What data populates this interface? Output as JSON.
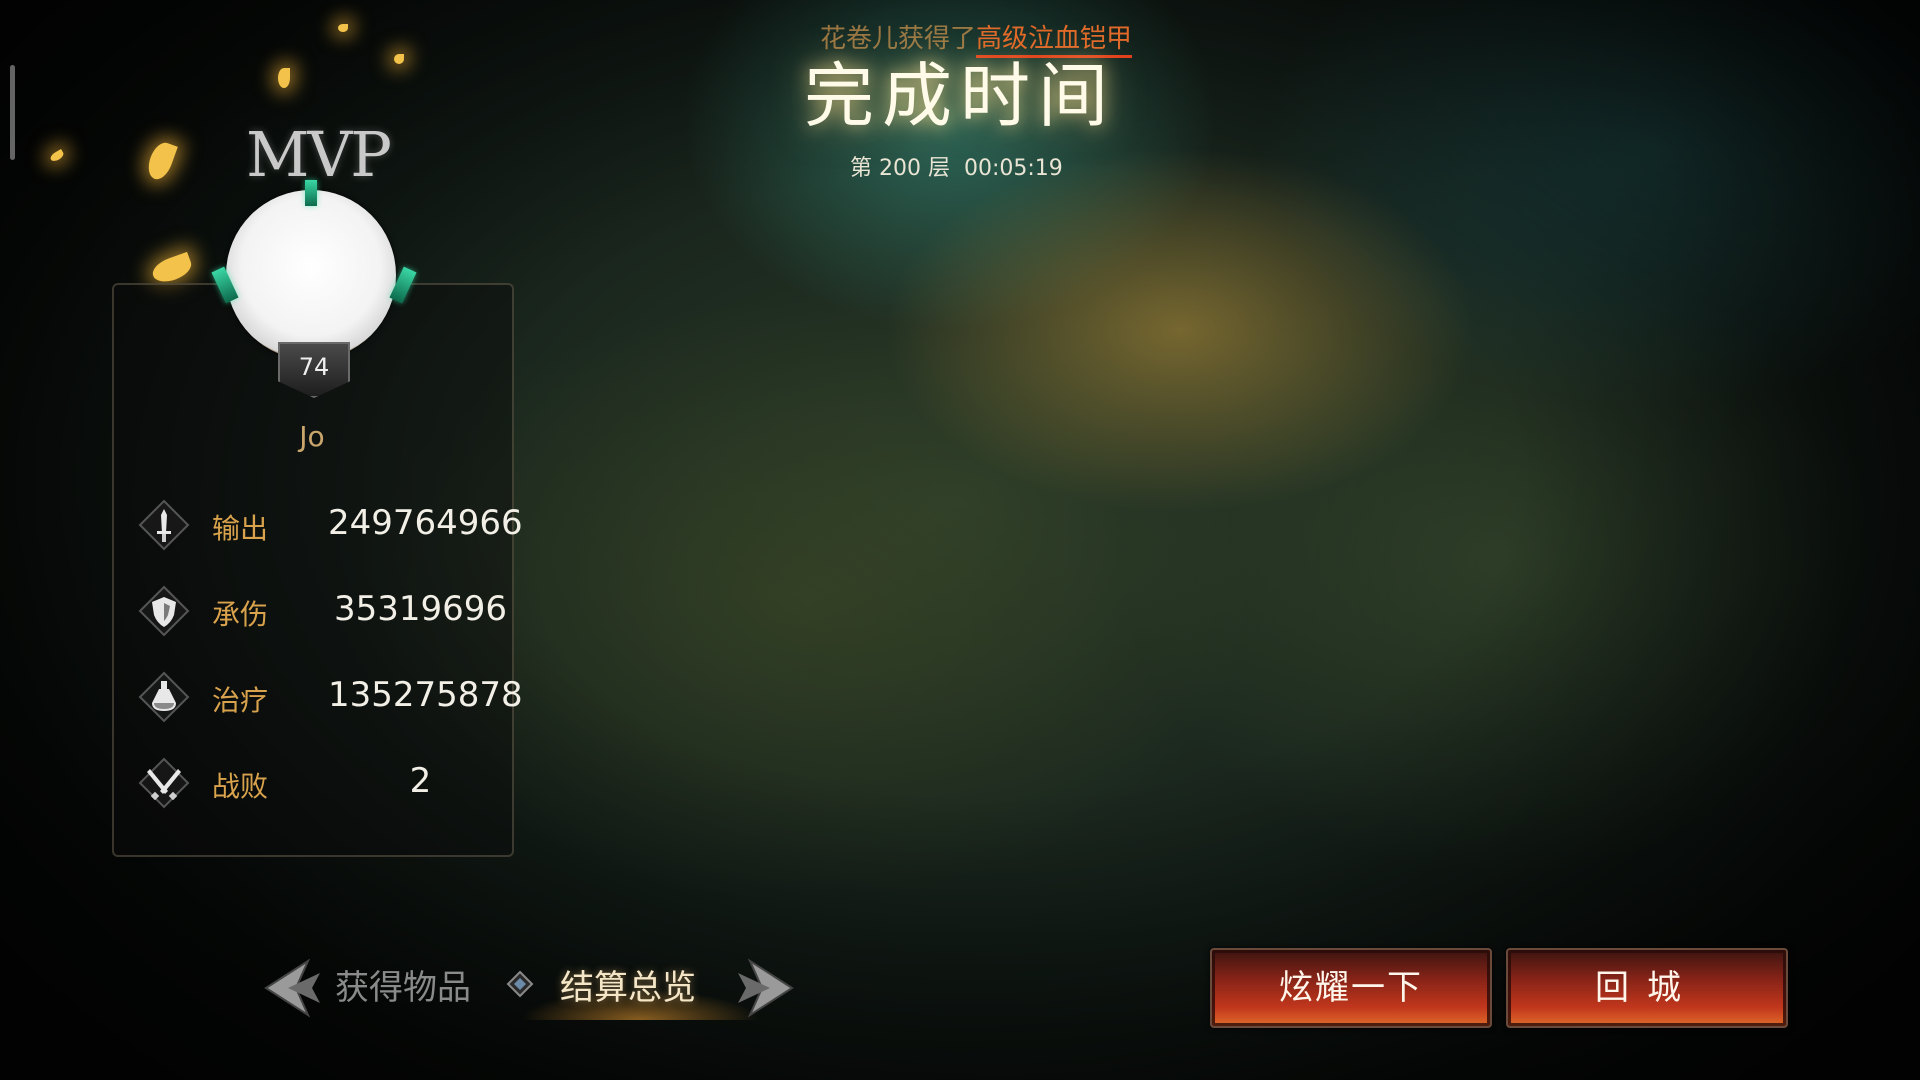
{
  "header": {
    "notice_player": "花卷儿获得了",
    "notice_item": "高级泣血铠甲",
    "title": "完成时间",
    "floor": "第 200 层",
    "time": "00:05:19"
  },
  "mvp": {
    "label": "MVP",
    "level": "74",
    "name": "Jo"
  },
  "stats": [
    {
      "icon": "sword-icon",
      "label": "输出",
      "value": "249764966"
    },
    {
      "icon": "shield-icon",
      "label": "承伤",
      "value": "35319696"
    },
    {
      "icon": "potion-icon",
      "label": "治疗",
      "value": "135275878"
    },
    {
      "icon": "crossed-swords-icon",
      "label": "战败",
      "value": "2"
    }
  ],
  "tabs": {
    "inactive": "获得物品",
    "active": "结算总览"
  },
  "buttons": {
    "show_off": "炫耀一下",
    "return_city": "回城"
  },
  "colors": {
    "stat_label": "#d9a24c",
    "notice_item": "#e06a2a",
    "button_red": "#c0361c"
  }
}
